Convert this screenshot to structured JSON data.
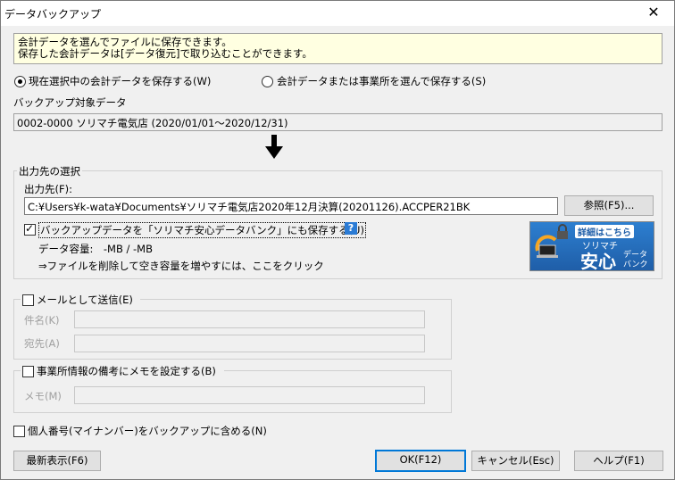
{
  "window": {
    "title": "データバックアップ",
    "close": "✕"
  },
  "info": {
    "line1": "会計データを選んでファイルに保存できます。",
    "line2": "保存した会計データは[データ復元]で取り込むことができます。"
  },
  "mode": {
    "option1": "現在選択中の会計データを保存する(W)",
    "option2": "会計データまたは事業所を選んで保存する(S)"
  },
  "target": {
    "label": "バックアップ対象データ",
    "value": "0002-0000 ソリマチ電気店 (2020/01/01～2020/12/31)"
  },
  "arrow": "🠗",
  "output": {
    "group_label": "出力先の選択",
    "path_label": "出力先(F):",
    "path_value": "C:¥Users¥k-wata¥Documents¥ソリマチ電気店2020年12月決算(20201126).ACCPER21BK",
    "browse_button": "参照(F5)...",
    "bank_checkbox": "バックアップデータを「ソリマチ安心データバンク」にも保存する(U)",
    "help": "?",
    "capacity": "データ容量:　-MB / -MB",
    "hint": "⇒ファイルを削除して空き容量を増やすには、ここをクリック",
    "banner": {
      "tag": "詳細はこちら",
      "brand": "ソリマチ",
      "big": "安心",
      "sub1": "データ",
      "sub2": "バンク"
    }
  },
  "mail": {
    "checkbox": "メールとして送信(E)",
    "subject_label": "件名(K)",
    "to_label": "宛先(A)"
  },
  "memo": {
    "checkbox": "事業所情報の備考にメモを設定する(B)",
    "memo_label": "メモ(M)"
  },
  "mynumber": {
    "checkbox": "個人番号(マイナンバー)をバックアップに含める(N)"
  },
  "buttons": {
    "refresh": "最新表示(F6)",
    "ok": "OK(F12)",
    "cancel": "キャンセル(Esc)",
    "help": "ヘルプ(F1)"
  }
}
